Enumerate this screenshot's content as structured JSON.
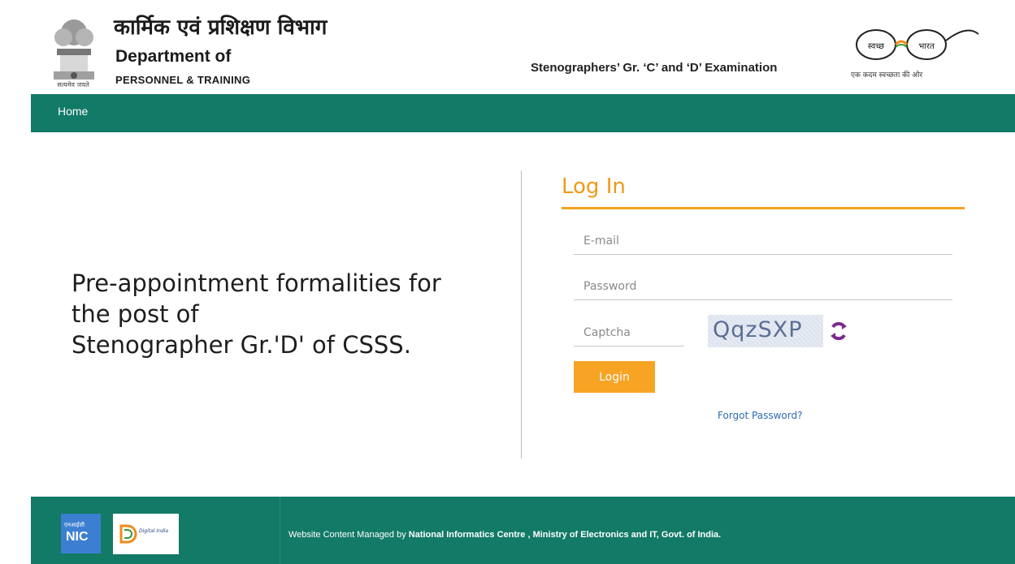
{
  "header": {
    "hindi_title": "कार्मिक एवं प्रशिक्षण विभाग",
    "dept_title": "Department of",
    "dept_subtitle": "PERSONNEL & TRAINING",
    "emblem_caption": "सत्यमेव जयते",
    "exam_title": "Stenographers’ Gr. ‘C’ and ‘D’ Examination",
    "swachh_left": "स्वच्छ",
    "swachh_right": "भारत",
    "swachh_caption": "एक कदम स्वच्छता की ओर"
  },
  "nav": {
    "home_label": "Home"
  },
  "main": {
    "lead_line1": "Pre-appointment formalities for",
    "lead_line2": "the post of",
    "lead_line3": "Stenographer Gr.'D' of CSSS."
  },
  "login": {
    "title": "Log In",
    "email_placeholder": "E-mail",
    "password_placeholder": "Password",
    "captcha_placeholder": "Captcha",
    "captcha_text": "QqzSXP",
    "button_label": "Login",
    "forgot_label": "Forgot Password?"
  },
  "footer": {
    "nic_top": "एनआईसी",
    "nic_main": "NIC",
    "digital_india": "Digital India",
    "text_prefix": "Website Content Managed by ",
    "text_org": "National Informatics Centre , Ministry of Electronics and IT, Govt. of India."
  },
  "colors": {
    "brand_green": "#127a67",
    "accent_orange": "#f7a323",
    "link_blue": "#2e6ab1"
  }
}
